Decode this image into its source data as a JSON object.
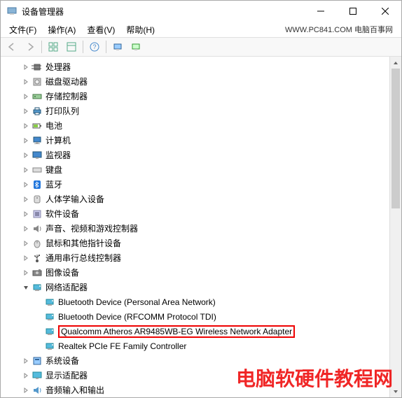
{
  "window": {
    "title": "设备管理器"
  },
  "menu": {
    "file": "文件(F)",
    "action": "操作(A)",
    "view": "查看(V)",
    "help": "帮助(H)"
  },
  "watermark": "WWW.PC841.COM 电脑百事网",
  "tree": [
    {
      "level": 1,
      "icon": "cpu",
      "label": "处理器",
      "exp": "collapsed"
    },
    {
      "level": 1,
      "icon": "disk",
      "label": "磁盘驱动器",
      "exp": "collapsed"
    },
    {
      "level": 1,
      "icon": "storage",
      "label": "存储控制器",
      "exp": "collapsed"
    },
    {
      "level": 1,
      "icon": "printer",
      "label": "打印队列",
      "exp": "collapsed"
    },
    {
      "level": 1,
      "icon": "battery",
      "label": "电池",
      "exp": "collapsed"
    },
    {
      "level": 1,
      "icon": "computer",
      "label": "计算机",
      "exp": "collapsed"
    },
    {
      "level": 1,
      "icon": "monitor",
      "label": "监视器",
      "exp": "collapsed"
    },
    {
      "level": 1,
      "icon": "keyboard",
      "label": "键盘",
      "exp": "collapsed"
    },
    {
      "level": 1,
      "icon": "bluetooth",
      "label": "蓝牙",
      "exp": "collapsed"
    },
    {
      "level": 1,
      "icon": "hid",
      "label": "人体学输入设备",
      "exp": "collapsed"
    },
    {
      "level": 1,
      "icon": "software",
      "label": "软件设备",
      "exp": "collapsed"
    },
    {
      "level": 1,
      "icon": "sound",
      "label": "声音、视频和游戏控制器",
      "exp": "collapsed"
    },
    {
      "level": 1,
      "icon": "mouse",
      "label": "鼠标和其他指针设备",
      "exp": "collapsed"
    },
    {
      "level": 1,
      "icon": "usb",
      "label": "通用串行总线控制器",
      "exp": "collapsed"
    },
    {
      "level": 1,
      "icon": "camera",
      "label": "图像设备",
      "exp": "collapsed"
    },
    {
      "level": 1,
      "icon": "network",
      "label": "网络适配器",
      "exp": "expanded"
    },
    {
      "level": 2,
      "icon": "network",
      "label": "Bluetooth Device (Personal Area Network)",
      "exp": "none"
    },
    {
      "level": 2,
      "icon": "network",
      "label": "Bluetooth Device (RFCOMM Protocol TDI)",
      "exp": "none"
    },
    {
      "level": 2,
      "icon": "network",
      "label": "Qualcomm Atheros AR9485WB-EG Wireless Network Adapter",
      "exp": "none",
      "highlight": true
    },
    {
      "level": 2,
      "icon": "network",
      "label": "Realtek PCIe FE Family Controller",
      "exp": "none"
    },
    {
      "level": 1,
      "icon": "system",
      "label": "系统设备",
      "exp": "collapsed"
    },
    {
      "level": 1,
      "icon": "display",
      "label": "显示适配器",
      "exp": "collapsed"
    },
    {
      "level": 1,
      "icon": "audio",
      "label": "音频输入和输出",
      "exp": "collapsed"
    }
  ],
  "overlay": "电脑软硬件教程网"
}
